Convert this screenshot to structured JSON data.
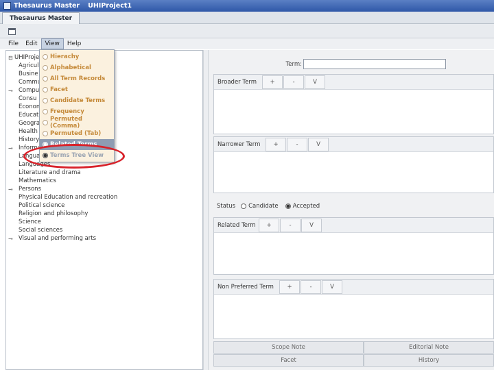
{
  "titlebar": {
    "app_title": "Thesaurus Master",
    "project": "UHIProject1"
  },
  "tab": {
    "label": "Thesaurus Master"
  },
  "menubar": {
    "items": [
      "File",
      "Edit",
      "View",
      "Help"
    ]
  },
  "view_menu": {
    "items": [
      "Hierachy",
      "Alphabetical",
      "All Term Records",
      "Facet",
      "Candidate Terms",
      "Frequency",
      "Permuted (Comma)",
      "Permuted (Tab)",
      "Related Terms",
      "Terms Tree View"
    ]
  },
  "tree": {
    "items": [
      "UHIProject",
      "Agricult",
      "Busine",
      "Commu",
      "Compu",
      "Consu",
      "Econom",
      "Educat",
      "Geogra",
      "Health",
      "History",
      "Informa",
      "Langua",
      "Languages",
      "Literature and drama",
      "Mathematics",
      "Persons",
      "Physical Education and recreation",
      "Political science",
      "Religion and philosophy",
      "Science",
      "Social sciences",
      "Visual and performing arts"
    ]
  },
  "term": {
    "label": "Term:",
    "value": ""
  },
  "sections": {
    "broader": {
      "title": "Broader Term",
      "add": "+",
      "remove": "-",
      "view": "V"
    },
    "narrower": {
      "title": "Narrower Term",
      "add": "+",
      "remove": "-",
      "view": "V"
    },
    "related": {
      "title": "Related Term",
      "add": "+",
      "remove": "-",
      "view": "V"
    },
    "nonpreferred": {
      "title": "Non Preferred Term",
      "add": "+",
      "remove": "-",
      "view": "V"
    }
  },
  "status": {
    "label": "Status",
    "candidate": "Candidate",
    "accepted": "Accepted",
    "selected": "Accepted"
  },
  "bottom_tabs": {
    "scope_note": "Scope Note",
    "editorial_note": "Editorial Note",
    "facet": "Facet",
    "history": "History"
  },
  "colors": {
    "annotation": "#d8222a",
    "menu_text": "#c58a3a",
    "menu_highlight": "#8e9cb3"
  }
}
